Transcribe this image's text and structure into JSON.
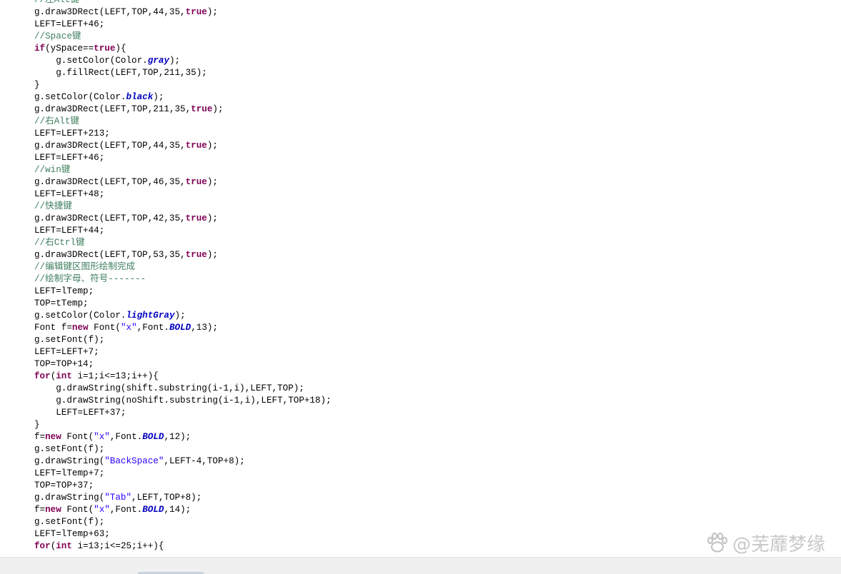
{
  "code_lines": [
    [
      {
        "t": "//左Alt键",
        "c": "cm"
      }
    ],
    [
      {
        "t": "g.draw3DRect(LEFT,TOP,44,35,"
      },
      {
        "t": "true",
        "c": "kw"
      },
      {
        "t": ");"
      }
    ],
    [
      {
        "t": "LEFT=LEFT+46;"
      }
    ],
    [
      {
        "t": "//Space键",
        "c": "cm"
      }
    ],
    [
      {
        "t": "if",
        "c": "kw"
      },
      {
        "t": "(ySpace=="
      },
      {
        "t": "true",
        "c": "kw"
      },
      {
        "t": "){"
      }
    ],
    [
      {
        "t": "    g.setColor(Color."
      },
      {
        "t": "gray",
        "c": "it"
      },
      {
        "t": ");"
      }
    ],
    [
      {
        "t": "    g.fillRect(LEFT,TOP,211,35);"
      }
    ],
    [
      {
        "t": "}"
      }
    ],
    [
      {
        "t": "g.setColor(Color."
      },
      {
        "t": "black",
        "c": "it"
      },
      {
        "t": ");"
      }
    ],
    [
      {
        "t": "g.draw3DRect(LEFT,TOP,211,35,"
      },
      {
        "t": "true",
        "c": "kw"
      },
      {
        "t": ");"
      }
    ],
    [
      {
        "t": "//右Alt键",
        "c": "cm"
      }
    ],
    [
      {
        "t": "LEFT=LEFT+213;"
      }
    ],
    [
      {
        "t": "g.draw3DRect(LEFT,TOP,44,35,"
      },
      {
        "t": "true",
        "c": "kw"
      },
      {
        "t": ");"
      }
    ],
    [
      {
        "t": "LEFT=LEFT+46;"
      }
    ],
    [
      {
        "t": "//win键",
        "c": "cm"
      }
    ],
    [
      {
        "t": "g.draw3DRect(LEFT,TOP,46,35,"
      },
      {
        "t": "true",
        "c": "kw"
      },
      {
        "t": ");"
      }
    ],
    [
      {
        "t": "LEFT=LEFT+48;"
      }
    ],
    [
      {
        "t": "//快捷键",
        "c": "cm"
      }
    ],
    [
      {
        "t": "g.draw3DRect(LEFT,TOP,42,35,"
      },
      {
        "t": "true",
        "c": "kw"
      },
      {
        "t": ");"
      }
    ],
    [
      {
        "t": "LEFT=LEFT+44;"
      }
    ],
    [
      {
        "t": "//右Ctrl键",
        "c": "cm"
      }
    ],
    [
      {
        "t": "g.draw3DRect(LEFT,TOP,53,35,"
      },
      {
        "t": "true",
        "c": "kw"
      },
      {
        "t": ");"
      }
    ],
    [
      {
        "t": "//编辑键区图形绘制完成",
        "c": "cm"
      }
    ],
    [
      {
        "t": "//绘制字母、符号-------",
        "c": "cm"
      }
    ],
    [
      {
        "t": "LEFT=lTemp;"
      }
    ],
    [
      {
        "t": "TOP=tTemp;"
      }
    ],
    [
      {
        "t": "g.setColor(Color."
      },
      {
        "t": "lightGray",
        "c": "it"
      },
      {
        "t": ");"
      }
    ],
    [
      {
        "t": "Font f="
      },
      {
        "t": "new",
        "c": "kw"
      },
      {
        "t": " Font("
      },
      {
        "t": "\"x\"",
        "c": "st"
      },
      {
        "t": ",Font."
      },
      {
        "t": "BOLD",
        "c": "it"
      },
      {
        "t": ",13);"
      }
    ],
    [
      {
        "t": "g.setFont(f);"
      }
    ],
    [
      {
        "t": "LEFT=LEFT+7;"
      }
    ],
    [
      {
        "t": "TOP=TOP+14;"
      }
    ],
    [
      {
        "t": "for",
        "c": "kw"
      },
      {
        "t": "("
      },
      {
        "t": "int",
        "c": "kw"
      },
      {
        "t": " i=1;i<=13;i++){"
      }
    ],
    [
      {
        "t": "    g.drawString(shift.substring(i-1,i),LEFT,TOP);"
      }
    ],
    [
      {
        "t": "    g.drawString(noShift.substring(i-1,i),LEFT,TOP+18);"
      }
    ],
    [
      {
        "t": "    LEFT=LEFT+37;"
      }
    ],
    [
      {
        "t": "}"
      }
    ],
    [
      {
        "t": "f="
      },
      {
        "t": "new",
        "c": "kw"
      },
      {
        "t": " Font("
      },
      {
        "t": "\"x\"",
        "c": "st"
      },
      {
        "t": ",Font."
      },
      {
        "t": "BOLD",
        "c": "it"
      },
      {
        "t": ",12);"
      }
    ],
    [
      {
        "t": "g.setFont(f);"
      }
    ],
    [
      {
        "t": "g.drawString("
      },
      {
        "t": "\"BackSpace\"",
        "c": "st"
      },
      {
        "t": ",LEFT-4,TOP+8);"
      }
    ],
    [
      {
        "t": "LEFT=lTemp+7;"
      }
    ],
    [
      {
        "t": "TOP=TOP+37;"
      }
    ],
    [
      {
        "t": "g.drawString("
      },
      {
        "t": "\"Tab\"",
        "c": "st"
      },
      {
        "t": ",LEFT,TOP+8);"
      }
    ],
    [
      {
        "t": "f="
      },
      {
        "t": "new",
        "c": "kw"
      },
      {
        "t": " Font("
      },
      {
        "t": "\"x\"",
        "c": "st"
      },
      {
        "t": ",Font."
      },
      {
        "t": "BOLD",
        "c": "it"
      },
      {
        "t": ",14);"
      }
    ],
    [
      {
        "t": "g.setFont(f);"
      }
    ],
    [
      {
        "t": "LEFT=lTemp+63;"
      }
    ],
    [
      {
        "t": "for",
        "c": "kw"
      },
      {
        "t": "("
      },
      {
        "t": "int",
        "c": "kw"
      },
      {
        "t": " i=13;i<=25;i++){"
      }
    ]
  ],
  "watermark": {
    "text": "@芜蘼梦缘",
    "logo_icon": "paw-logo-icon"
  },
  "colors": {
    "keyword": "#7f0055",
    "string": "#2a00ff",
    "comment": "#3f7f5f",
    "static_field": "#0000c0",
    "bottom_bar": "#f0f0f0"
  }
}
